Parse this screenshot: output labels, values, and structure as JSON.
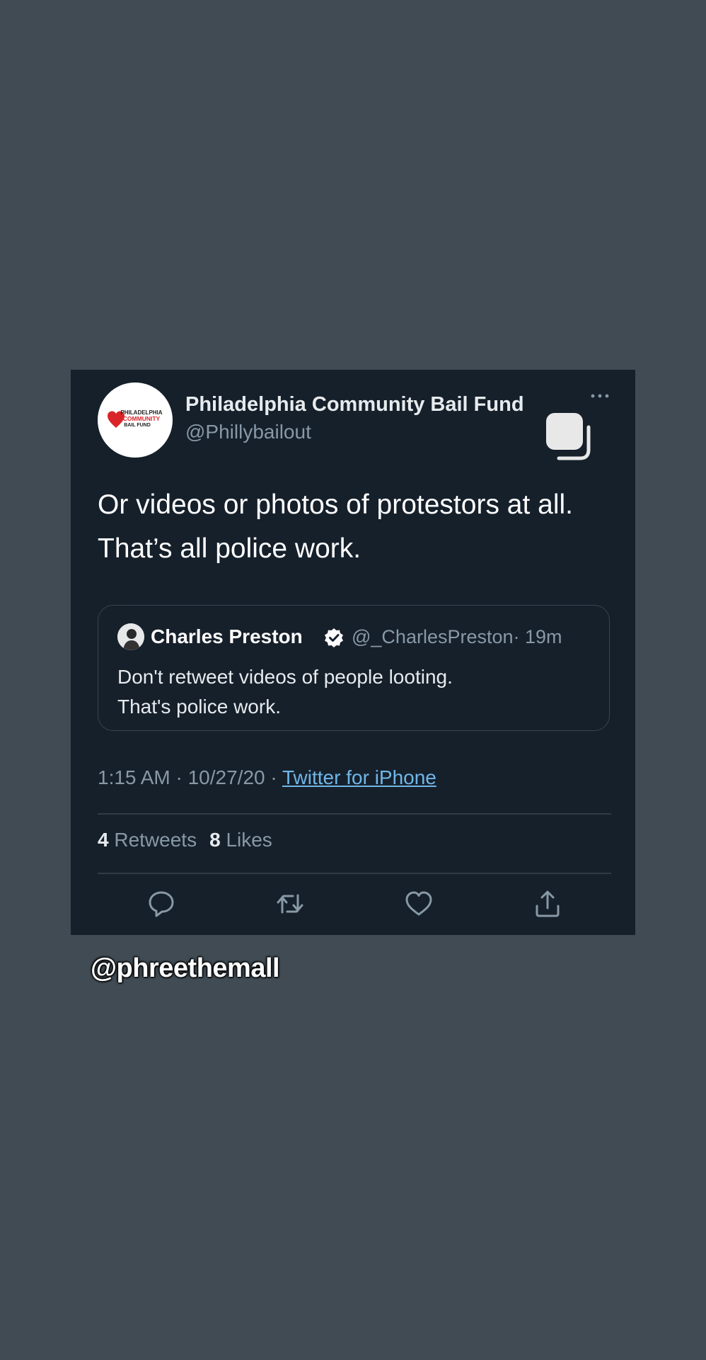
{
  "tweet": {
    "author_name": "Philadelphia Community Bail Fund",
    "author_handle": "@Phillybailout",
    "avatar_logo_text": [
      "PHILADELPHIA",
      "COMMUNITY",
      "BAIL FUND"
    ],
    "text_lines": [
      "Or videos or photos of protestors at all.",
      "That’s all police work."
    ],
    "quoted": {
      "author_name": "Charles Preston",
      "verified": true,
      "author_handle": "@_CharlesPreston",
      "time_ago": "· 19m",
      "text_lines": [
        "Don't retweet videos of people looting.",
        "That's police work."
      ]
    },
    "timestamp": "1:15 AM · 10/27/20 ·",
    "source": "Twitter for iPhone",
    "retweets_count": "4",
    "retweets_label": "Retweets",
    "likes_count": "8",
    "likes_label": "Likes"
  },
  "actions": [
    "reply-icon",
    "retweet-icon",
    "like-icon",
    "share-icon"
  ],
  "story_tag": "@phreethemall",
  "colors": {
    "page_background": "#404b53",
    "card_background": "#16202b",
    "secondary_text": "#8899a6",
    "link": "#6fb6e8",
    "logo_red": "#d9252a"
  }
}
